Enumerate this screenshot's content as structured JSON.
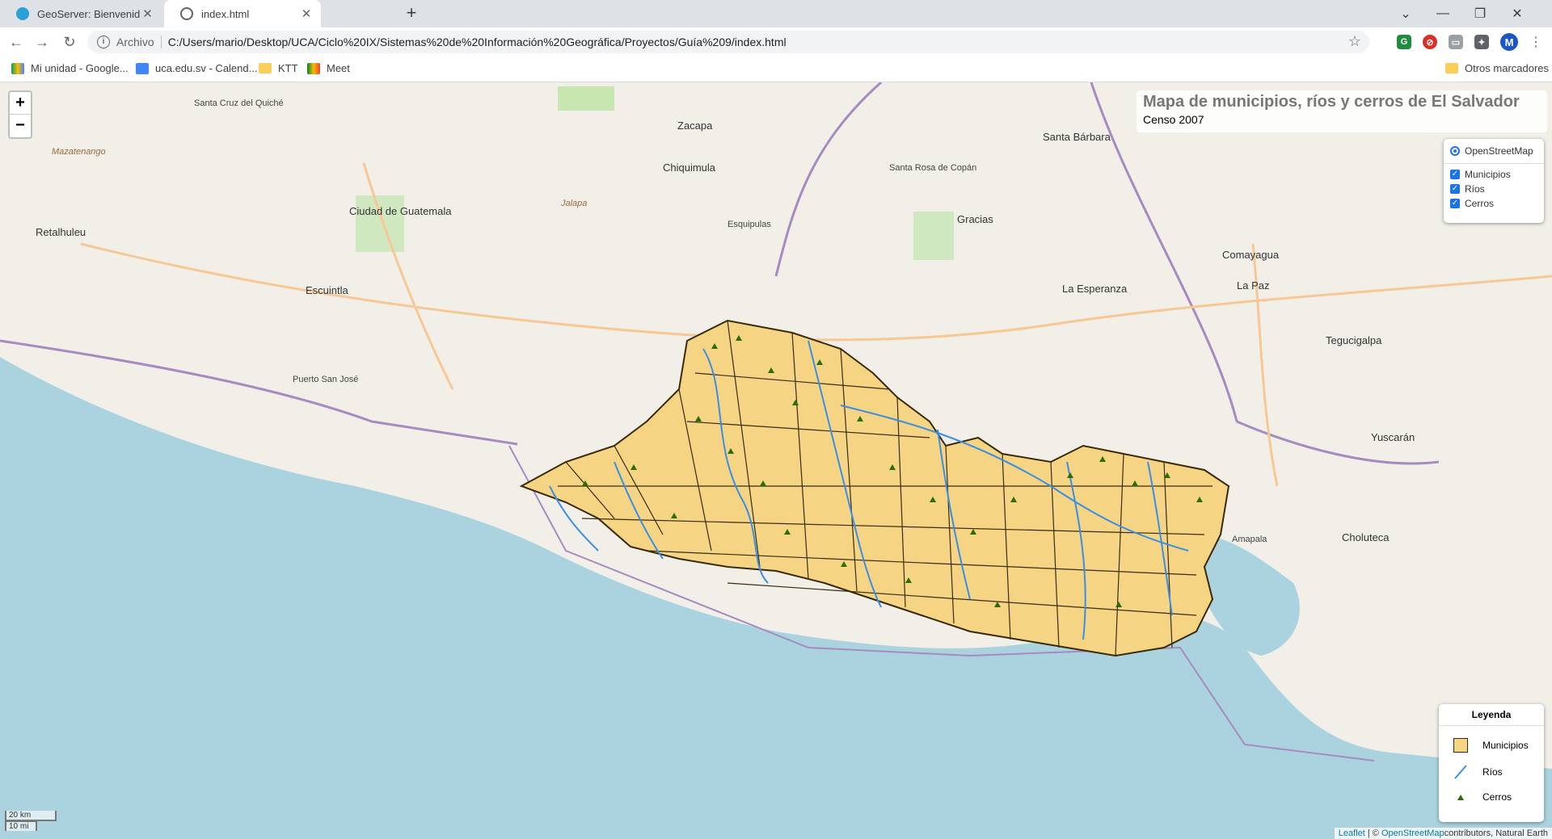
{
  "tabs": [
    {
      "title": "GeoServer: Bienvenido",
      "active": false
    },
    {
      "title": "index.html",
      "active": true
    }
  ],
  "omnibox": {
    "scheme": "Archivo",
    "url": "C:/Users/mario/Desktop/UCA/Ciclo%20IX/Sistemas%20de%20Información%20Geográfica/Proyectos/Guía%209/index.html"
  },
  "profile_initial": "M",
  "bookmarks": [
    {
      "label": "Mi unidad - Google...",
      "icon": "drive-icon"
    },
    {
      "label": "uca.edu.sv - Calend...",
      "icon": "calendar-icon"
    },
    {
      "label": "KTT",
      "icon": "folder-icon"
    },
    {
      "label": "Meet",
      "icon": "meet-icon"
    }
  ],
  "other_bookmarks": "Otros marcadores",
  "map": {
    "zoom_in": "+",
    "zoom_out": "−",
    "title": "Mapa de municipios, ríos y cerros de El Salvador",
    "subtitle": "Censo 2007",
    "layer_control": {
      "base": "OpenStreetMap",
      "overlays": [
        "Municipios",
        "Ríos",
        "Cerros"
      ]
    },
    "legend": {
      "title": "Leyenda",
      "items": [
        "Municipios",
        "Ríos",
        "Cerros"
      ]
    },
    "scale": {
      "metric": "20 km",
      "imperial": "10 mi"
    },
    "attribution": {
      "leaflet": "Leaflet",
      "sep": " | © ",
      "osm": "OpenStreetMap",
      "rest": "contributors, Natural Earth"
    },
    "place_labels": [
      "Ciudad de Guatemala",
      "Escuintla",
      "Chiquimula",
      "Zacapa",
      "Santa Rosa de Copán",
      "Gracias",
      "Comayagua",
      "La Esperanza",
      "Tegucigalpa",
      "Choluteca",
      "Yuscarán",
      "La Paz",
      "Santa Bárbara",
      "Jalapa",
      "Esquipulas",
      "Santa Cruz del Quiché",
      "Retalhuleu",
      "Mazatenango",
      "Puerto San José",
      "Amapala"
    ]
  },
  "colors": {
    "municipio_fill": "#f5d583",
    "municipio_border": "#3a2a0a",
    "rios": "#3b8ee6",
    "cerros": "#2e6b00",
    "sea": "#aad3df"
  }
}
